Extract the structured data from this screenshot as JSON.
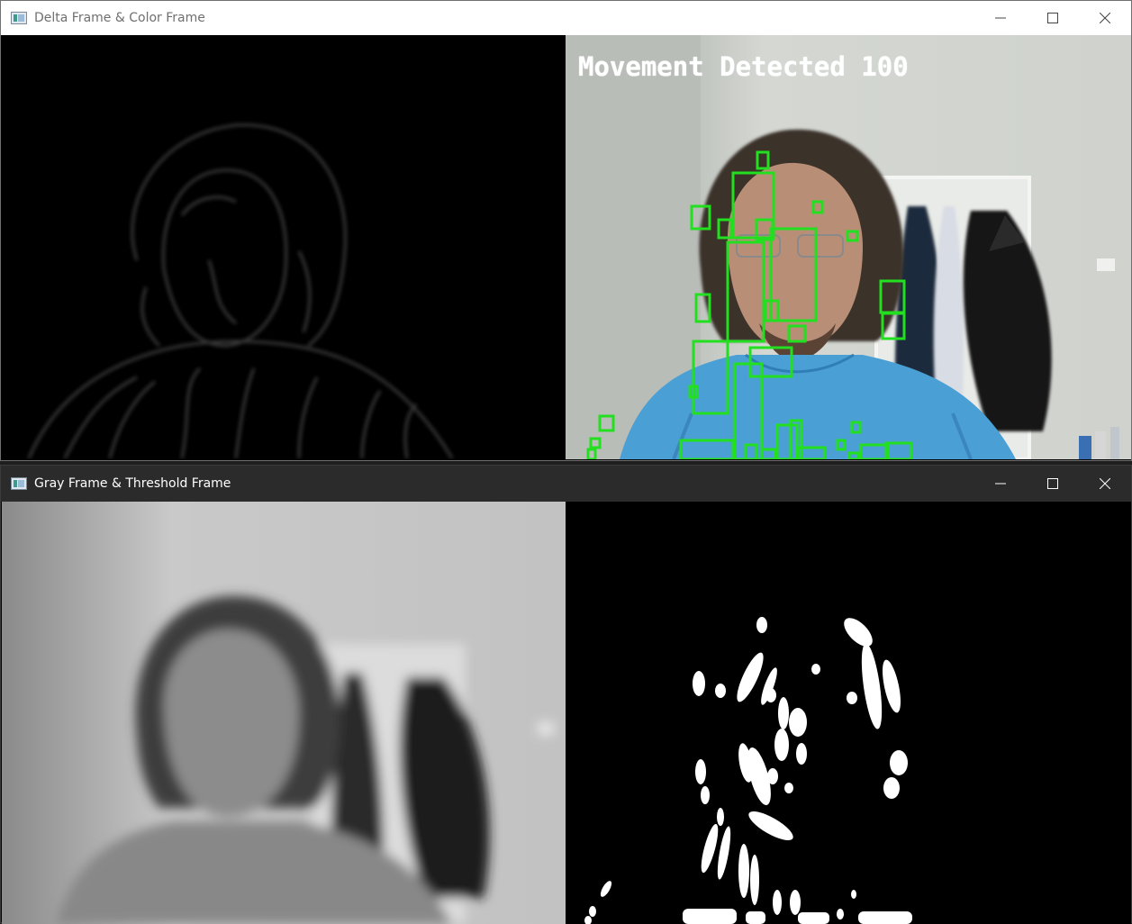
{
  "window_top": {
    "title": "Delta Frame & Color Frame",
    "overlay_text": "Movement Detected 100"
  },
  "window_bottom": {
    "title": "Gray Frame & Threshold Frame"
  },
  "colors": {
    "detection_box": "#22e01f",
    "threshold_blob": "#ffffff",
    "wall": "#c8ccc9",
    "shirt": "#4a9fd4"
  },
  "icons": {
    "app": "opencv-window-icon",
    "minimize": "minimize-icon",
    "maximize": "maximize-icon",
    "close": "close-icon"
  }
}
